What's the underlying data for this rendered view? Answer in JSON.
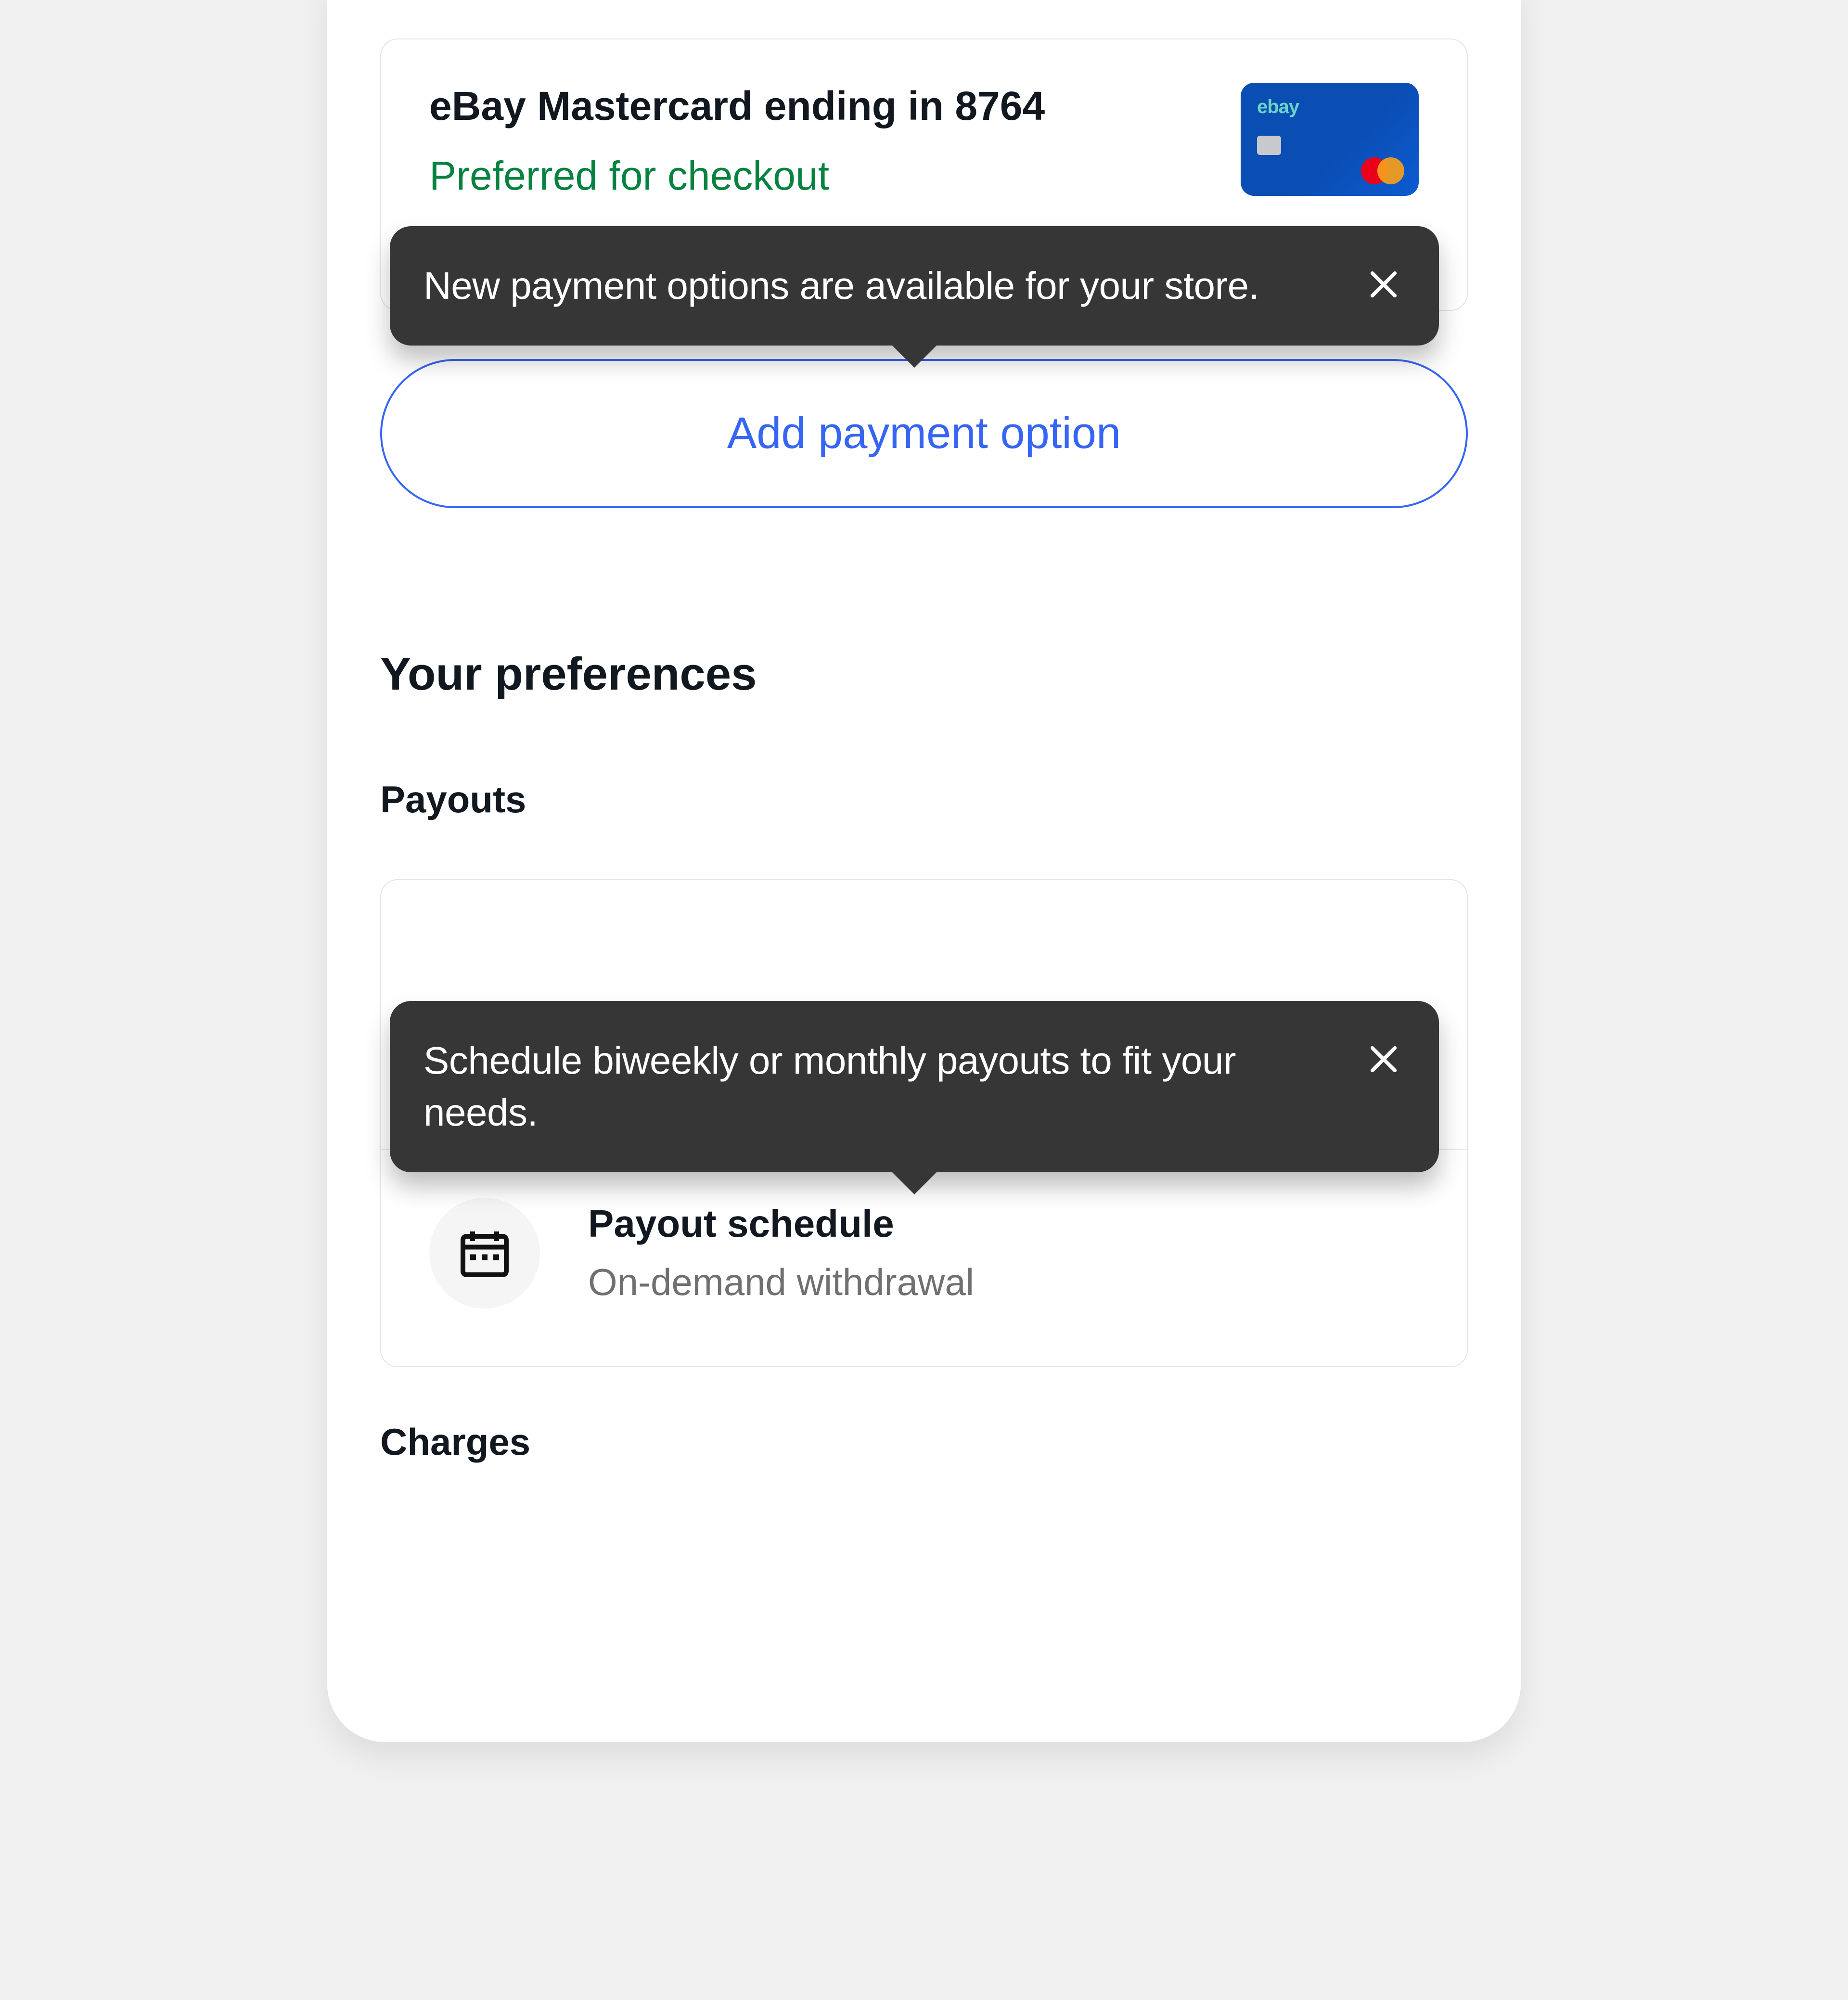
{
  "card": {
    "title": "eBay Mastercard ending in 8764",
    "preferred_label": "Preferred for checkout",
    "brand_mark": "ebay"
  },
  "tooltip_payment": {
    "text": "New payment options are available for your store."
  },
  "add_button_label": "Add payment option",
  "headings": {
    "preferences": "Your preferences",
    "payouts": "Payouts",
    "charges": "Charges"
  },
  "tooltip_payout": {
    "text": "Schedule biweekly or monthly payouts to fit your needs."
  },
  "payout_schedule": {
    "title": "Payout schedule",
    "value": "On-demand withdrawal"
  },
  "colors": {
    "link_blue": "#3665f3",
    "success_green": "#05823f",
    "tooltip_bg": "#363636"
  }
}
